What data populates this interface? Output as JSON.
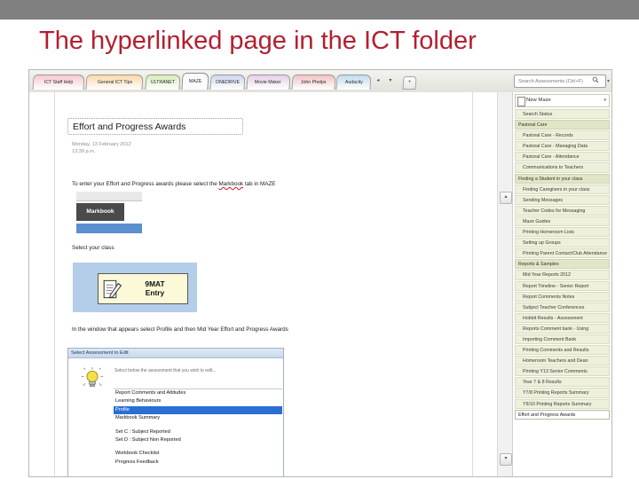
{
  "slide": {
    "title": "The hyperlinked page in the ICT folder",
    "title_color": "#b22030",
    "topbar_color": "#808080"
  },
  "workbook": {
    "tabs": [
      {
        "label": "ICT Staff Help",
        "color": "#f6c9cd",
        "active": false
      },
      {
        "label": "General ICT Tips",
        "color": "#fbd9a8",
        "active": false
      },
      {
        "label": "ULTRANET",
        "color": "#d6edb9",
        "active": false
      },
      {
        "label": "MAZE",
        "color": "#ffffff",
        "active": true
      },
      {
        "label": "ONEDRIVE",
        "color": "#cfd5ef",
        "active": false
      },
      {
        "label": "Movie Maker",
        "color": "#e4cfe8",
        "active": false
      },
      {
        "label": "John Phelps",
        "color": "#f3c3c3",
        "active": false
      },
      {
        "label": "Audacity",
        "color": "#bfdced",
        "active": false
      }
    ],
    "nav_prev_label": "◂",
    "nav_next_label": "▾",
    "new_sheet_label": "+",
    "search": {
      "placeholder": "Search Assessments (Ctrl+F)",
      "icon": "search-icon",
      "caret": "▾"
    }
  },
  "document": {
    "title": "Effort and Progress Awards",
    "date": "Monday, 13 February 2012",
    "time": "13:39 p.m.",
    "instruction_1_pre": "To enter your Effort and Progress awards please select the ",
    "instruction_1_link": "Markbook",
    "instruction_1_post": " tab in MAZE",
    "markbook_button": "Markbook",
    "select_class": "Select your class",
    "entry_button_line1": "9MAT",
    "entry_button_line2": "Entry",
    "entry_icon": "clipboard-pen-icon",
    "instruction_2": "In the window that appears select Profile and then Mid Year Effort and Progress Awards"
  },
  "dialog": {
    "title": "Select Assessment to Edit",
    "hint": "Select below the assessment that you wish to edit...",
    "bulb_icon": "lightbulb-icon",
    "items": [
      {
        "label": "Report Comments and Attitudes",
        "selected": false
      },
      {
        "label": "Learning Behaviours",
        "selected": false
      },
      {
        "label": "Profile",
        "selected": true
      },
      {
        "label": "Markbook Summary",
        "selected": false
      },
      {
        "label": "",
        "selected": false
      },
      {
        "label": "Set C : Subject Reported",
        "selected": false
      },
      {
        "label": "Set D : Subject Non Reported",
        "selected": false
      },
      {
        "label": "",
        "selected": false
      },
      {
        "label": "Workbook Checklist",
        "selected": false
      },
      {
        "label": "Progress Feedback",
        "selected": false
      }
    ],
    "selected_color": "#2a6fd4"
  },
  "scrollbar": {
    "up_arrow": "▴",
    "down_arrow": "▾"
  },
  "sidebar": {
    "header": {
      "label": "New Maze",
      "icon": "page-icon",
      "caret": "▾"
    },
    "items": [
      {
        "label": "Search Status",
        "type": "item"
      },
      {
        "label": "Pastoral Care",
        "type": "group"
      },
      {
        "label": "Pastoral Care - Records",
        "type": "item"
      },
      {
        "label": "Pastoral Care - Managing Data",
        "type": "item"
      },
      {
        "label": "Pastoral Care - Attendance",
        "type": "item"
      },
      {
        "label": "Communications to Teachers",
        "type": "item"
      },
      {
        "label": "Finding a Student in your class",
        "type": "group"
      },
      {
        "label": "Finding Caregivers in your class",
        "type": "item"
      },
      {
        "label": "Sending Messages",
        "type": "item"
      },
      {
        "label": "Teacher Codes for Messaging",
        "type": "item"
      },
      {
        "label": "Maze Guides",
        "type": "item"
      },
      {
        "label": "Printing Homeroom Lists",
        "type": "item"
      },
      {
        "label": "Setting up Groups",
        "type": "item"
      },
      {
        "label": "Printing Parent Contact/Club Attendance",
        "type": "item"
      },
      {
        "label": "Reports & Samples",
        "type": "group"
      },
      {
        "label": "Mid Year Reports 2012",
        "type": "item"
      },
      {
        "label": "Report Timeline - Senior Report",
        "type": "item"
      },
      {
        "label": "Report Comments Notes",
        "type": "item"
      },
      {
        "label": "Subject Teacher Conferences",
        "type": "item"
      },
      {
        "label": "Hobbit Results - Assessment",
        "type": "item"
      },
      {
        "label": "Reports Comment bank - Using",
        "type": "item"
      },
      {
        "label": "Importing Comment Bank",
        "type": "item"
      },
      {
        "label": "Printing Comments and Results",
        "type": "item"
      },
      {
        "label": "Homeroom Teachers and Dean",
        "type": "item"
      },
      {
        "label": "Printing Y13 Senior Comments",
        "type": "item"
      },
      {
        "label": "Year 7 & 8 Results",
        "type": "item"
      },
      {
        "label": "Y7/8 Printing Reports Summary",
        "type": "item"
      },
      {
        "label": "Y9/10 Printing Reports Summary",
        "type": "item"
      },
      {
        "label": "Effort and Progress Awards",
        "type": "current"
      }
    ]
  }
}
